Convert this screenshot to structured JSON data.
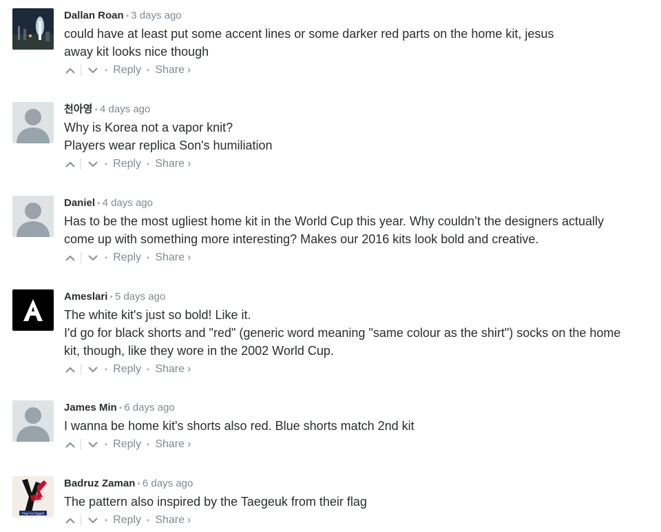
{
  "footer_labels": {
    "reply": "Reply",
    "share": "Share",
    "share_arrow": "›"
  },
  "comments": [
    {
      "author": "Dallan Roan",
      "time": "3 days ago",
      "avatar": "photo-avatar",
      "lines": [
        "could have at least put some accent lines or some darker red parts on the home kit, jesus",
        "away kit looks nice though"
      ]
    },
    {
      "author": "천아영",
      "time": "4 days ago",
      "avatar": "default-avatar",
      "lines": [
        "Why is Korea not a vapor knit?",
        "Players wear replica Son's humiliation"
      ]
    },
    {
      "author": "Daniel",
      "time": "4 days ago",
      "avatar": "default-avatar",
      "lines": [
        "Has to be the most ugliest home kit in the World Cup this year. Why couldn’t the designers actually",
        "come up with something more interesting? Makes our 2016 kits look bold and creative."
      ]
    },
    {
      "author": "Ameslari",
      "time": "5 days ago",
      "avatar": "letter-a-avatar",
      "lines": [
        "The white kit's just so bold! Like it.",
        "I'd go for black shorts and \"red\" (generic word meaning \"same colour as the shirt\") socks on the home",
        "kit, though, like they wore in the 2002 World Cup."
      ]
    },
    {
      "author": "James Min",
      "time": "6 days ago",
      "avatar": "default-avatar",
      "lines": [
        "I wanna be home kit's shorts also red. Blue shorts match 2nd kit"
      ]
    },
    {
      "author": "Badruz Zaman",
      "time": "6 days ago",
      "avatar": "poster-avatar",
      "avatar_text": "Pray For Egypt!!",
      "lines": [
        "The pattern also inspired by the Taegeuk from their flag"
      ]
    }
  ]
}
